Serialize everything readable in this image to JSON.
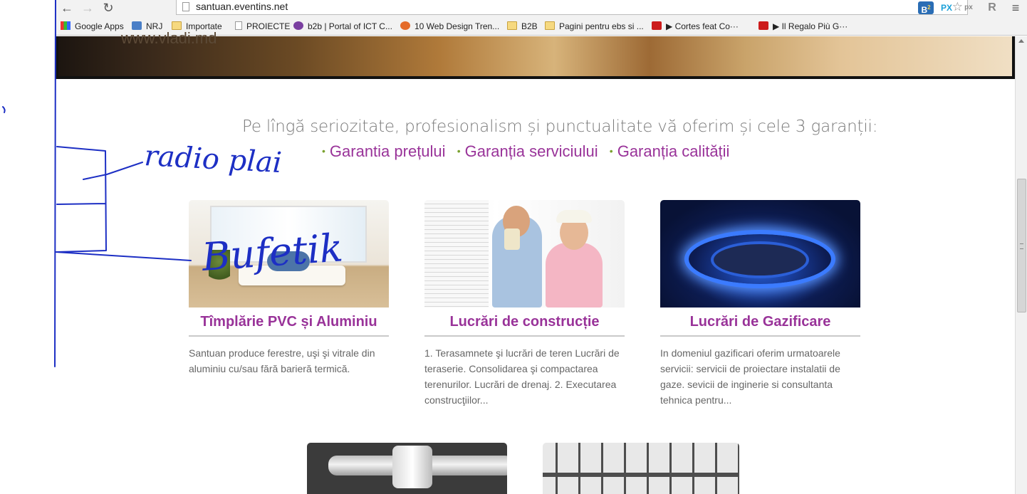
{
  "browser": {
    "url": "santuan.eventins.net",
    "nav": {
      "back": "←",
      "forward": "→",
      "reload": "↻"
    },
    "bookmark_star": "☆",
    "extensions": [
      {
        "label": "B",
        "badge": "2",
        "color": "#2a6db5"
      },
      {
        "label": "PX",
        "color": "#1aa0d8"
      },
      {
        "label": "px",
        "color": "#888888"
      },
      {
        "label": "R",
        "color": "#888888"
      },
      {
        "label": "≡",
        "color": "#555555"
      }
    ],
    "bookmarks": [
      {
        "label": "Google Apps",
        "icon": "apps-grid-icon"
      },
      {
        "label": "NRJ",
        "icon": "nrj-icon"
      },
      {
        "label": "Importate",
        "icon": "folder-icon"
      },
      {
        "label": "PROIECTE",
        "icon": "page-icon"
      },
      {
        "label": "b2b | Portal of ICT C...",
        "icon": "b2b-icon"
      },
      {
        "label": "10 Web Design Tren...",
        "icon": "puzzle-icon"
      },
      {
        "label": "B2B",
        "icon": "folder-icon"
      },
      {
        "label": "Pagini pentru ebs si ...",
        "icon": "folder-icon"
      },
      {
        "label": "▶ Cortes feat Co···",
        "icon": "youtube-icon"
      },
      {
        "label": "▶ Il Regalo Più G···",
        "icon": "youtube-icon"
      }
    ]
  },
  "hero": {
    "text": "www.vladi.md"
  },
  "intro": {
    "tagline": "Pe lîngă seriozitate, profesionalism și punctualitate vă oferim și cele 3 garanții:",
    "guarantees": [
      "Garantia prețului",
      "Garanția serviciului",
      "Garanția calității"
    ],
    "bullet": "•"
  },
  "cards": [
    {
      "title": "Tîmplărie PVC și Aluminiu",
      "desc": "Santuan produce ferestre, uşi şi  vitrale din aluminiu cu/sau fără barieră termică."
    },
    {
      "title": "Lucrări de construcție",
      "desc": "1. Terasamnete şi lucrări de teren Lucrări de teraserie. Consolidarea şi compactarea terenurilor. Lucrări de drenaj. 2. Executarea construcţiilor..."
    },
    {
      "title": "Lucrări de Gazificare",
      "desc": "In domeniul gazificari oferim urmatoarele servicii: servicii de proiectare instalatii de gaze. sevicii de inginerie si consultanta tehnica pentru..."
    }
  ],
  "handwriting": {
    "word1": "radio plai",
    "word2": "Bufetik"
  },
  "colors": {
    "accent": "#993399",
    "bullet": "#7aa22f",
    "annotation_ink": "#1d2fc4"
  }
}
